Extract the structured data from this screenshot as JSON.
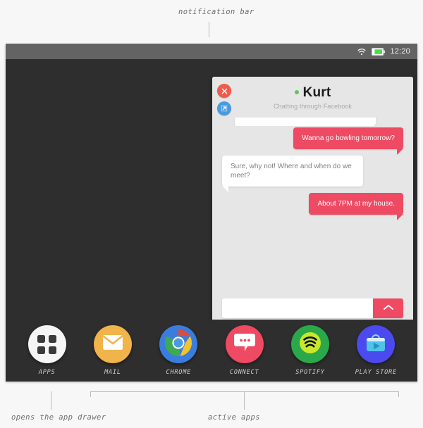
{
  "annotations": [
    {
      "id": "notification-bar",
      "text": "notification bar"
    },
    {
      "id": "app-drawer",
      "text": "opens the app drawer"
    },
    {
      "id": "active-apps",
      "text": "active apps"
    }
  ],
  "statusbar": {
    "time": "12:20",
    "icons": [
      "wifi-icon",
      "battery-icon"
    ],
    "battery_color": "#4ade4a",
    "background": "#636363"
  },
  "chat_window": {
    "contact_name": "Kurt",
    "subtitle": "Chatting through Facebook",
    "presence": "online",
    "presence_color": "#62c462",
    "close_label": "✕",
    "expand_label": "↗",
    "close_color": "#ef5b4c",
    "expand_color": "#4a9ae0",
    "messages": [
      {
        "direction": "out",
        "text": "Wanna go bowling tomorrow?"
      },
      {
        "direction": "in",
        "text": "Sure, why not! Where and when do we meet?"
      },
      {
        "direction": "out",
        "text": "About 7PM at my house."
      }
    ],
    "input": {
      "value": "",
      "placeholder": ""
    },
    "send_icon": "chevron-up-icon",
    "accent_color": "#ee4a63",
    "background": "#e6e6e6"
  },
  "dock": {
    "items": [
      {
        "label": "APPS",
        "icon": "apps-grid-icon",
        "color": "#f5f5f5"
      },
      {
        "label": "MAIL",
        "icon": "envelope-icon",
        "color": "#f0b44a"
      },
      {
        "label": "CHROME",
        "icon": "chrome-icon",
        "color": "#3b7ddd"
      },
      {
        "label": "CONNECT",
        "icon": "chat-bubble-icon",
        "color": "#ee4a63"
      },
      {
        "label": "SPOTIFY",
        "icon": "spotify-icon",
        "color": "#2aa84a"
      },
      {
        "label": "PLAY STORE",
        "icon": "play-store-icon",
        "color": "#4a4aee"
      }
    ]
  },
  "device": {
    "screen_background": "#2e2e2e",
    "page_background": "#f7f7f7"
  }
}
